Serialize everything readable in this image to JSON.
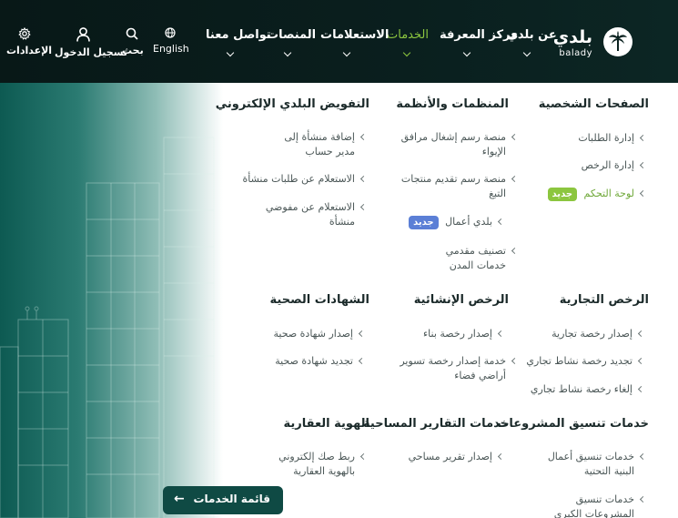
{
  "header": {
    "logo": {
      "arabic": "بلدي",
      "english": "balady",
      "emblem": "palm-emblem-icon"
    },
    "nav": [
      {
        "label": "عن بلدي",
        "active": false
      },
      {
        "label": "مركز المعرفة",
        "active": false
      },
      {
        "label": "الخدمات",
        "active": true
      },
      {
        "label": "الاستعلامات",
        "active": false
      },
      {
        "label": "المنصات",
        "active": false
      },
      {
        "label": "تواصل معنا",
        "active": false
      }
    ],
    "utilities": {
      "language": {
        "label": "English",
        "icon": "globe-icon"
      },
      "search": {
        "label": "بحث",
        "icon": "search-icon"
      },
      "login": {
        "label": "تسجيل الدخول",
        "icon": "user-icon"
      },
      "settings": {
        "label": "الإعدادات",
        "icon": "gear-icon"
      }
    },
    "colors": {
      "background": "#081817",
      "accent": "#8cc63f"
    }
  },
  "menu": {
    "personal_pages": {
      "title": "الصفحات الشخصية",
      "items": [
        "إدارة الطلبات",
        "إدارة الرخص",
        "لوحة التحكم"
      ],
      "badge": "جديد"
    },
    "platforms": {
      "title": "المنظمات والأنظمة",
      "items": [
        "منصة رسم إشغال مرافق الإيواء",
        "منصة رسم تقديم منتجات التبغ",
        "بلدي أعمال",
        "تصنيف مقدمي خدمات المدن"
      ],
      "badge": "جديد"
    },
    "delegation": {
      "title": "التفويض البلدي الإلكتروني",
      "items": [
        "إضافة منشأة إلى مدير حساب",
        "الاستعلام عن طلبات منشأة",
        "الاستعلام عن مفوضي منشأة"
      ]
    },
    "commercial": {
      "title": "الرخص التجارية",
      "items": [
        "إصدار رخصة تجارية",
        "تجديد رخصة نشاط تجاري",
        "إلغاء رخصة نشاط تجاري"
      ]
    },
    "construction": {
      "title": "الرخص الإنشائية",
      "items": [
        "إصدار رخصة بناء",
        "خدمة إصدار رخصة تسوير أراضي فضاء"
      ]
    },
    "health": {
      "title": "الشهادات الصحية",
      "items": [
        "إصدار شهادة صحية",
        "تجديد شهادة صحية"
      ]
    },
    "coordination": {
      "title": "خدمات تنسيق المشروعات",
      "items": [
        "خدمات تنسيق أعمال البنية التحتية",
        "خدمات تنسيق المشروعات الكبرى"
      ]
    },
    "survey": {
      "title": "خدمات التقارير المساحية",
      "items": [
        "إصدار تقرير مساحي"
      ]
    },
    "real_estate": {
      "title": "الهوية العقارية",
      "items": [
        "ربط صك إلكتروني بالهوية العقارية"
      ]
    }
  },
  "services_list_button": {
    "label": "قائمة الخدمات",
    "icon": "arrow-left-icon"
  }
}
